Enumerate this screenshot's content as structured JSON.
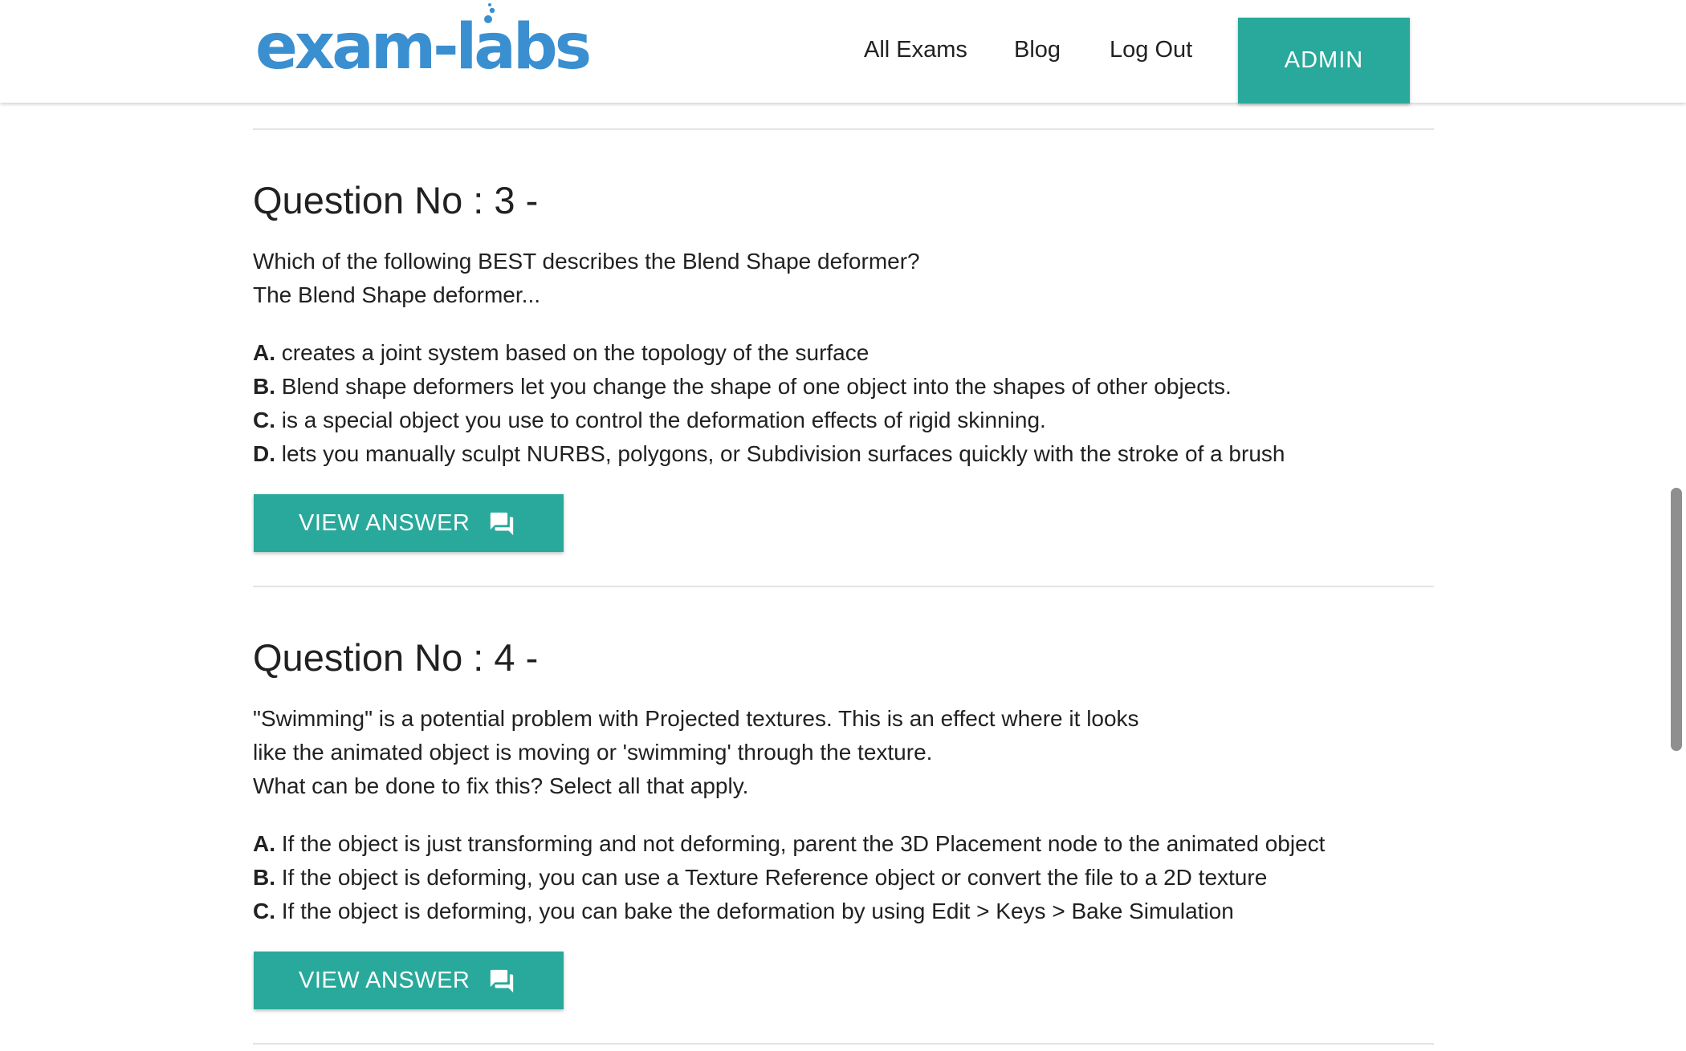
{
  "header": {
    "logo_text": "exam-labs",
    "nav": {
      "all_exams": "All Exams",
      "blog": "Blog",
      "log_out": "Log Out"
    },
    "admin_label": "ADMIN"
  },
  "questions": [
    {
      "title": "Question No : 3 -",
      "text_lines": [
        "Which of the following BEST describes the Blend Shape deformer?",
        "The Blend Shape deformer..."
      ],
      "options": [
        {
          "letter": "A.",
          "text": "creates a joint system based on the topology of the surface"
        },
        {
          "letter": "B.",
          "text": "Blend shape deformers let you change the shape of one object into the shapes of other objects."
        },
        {
          "letter": "C.",
          "text": "is a special object you use to control the deformation effects of rigid skinning."
        },
        {
          "letter": "D.",
          "text": "lets you manually sculpt NURBS, polygons, or Subdivision surfaces quickly with the stroke of a brush"
        }
      ],
      "button_label": "VIEW ANSWER"
    },
    {
      "title": "Question No : 4 -",
      "text_lines": [
        "\"Swimming\" is a potential problem with Projected textures. This is an effect where it looks",
        "like the animated object is moving or 'swimming' through the texture.",
        "What can be done to fix this? Select all that apply."
      ],
      "options": [
        {
          "letter": "A.",
          "text": "If the object is just transforming and not deforming, parent the 3D Placement node to the animated object"
        },
        {
          "letter": "B.",
          "text": "If the object is deforming, you can use a Texture Reference object or convert the file to a 2D texture"
        },
        {
          "letter": "C.",
          "text": "If the object is deforming, you can bake the deformation by using Edit > Keys > Bake Simulation"
        }
      ],
      "button_label": "VIEW ANSWER"
    }
  ],
  "colors": {
    "accent": "#28a99b",
    "logo": "#3a8fd0",
    "text": "#212121",
    "divider": "#e4e4e4"
  },
  "icons": {
    "view_answer": "forum-icon",
    "logo_bubbles": "bubbles-icon"
  }
}
